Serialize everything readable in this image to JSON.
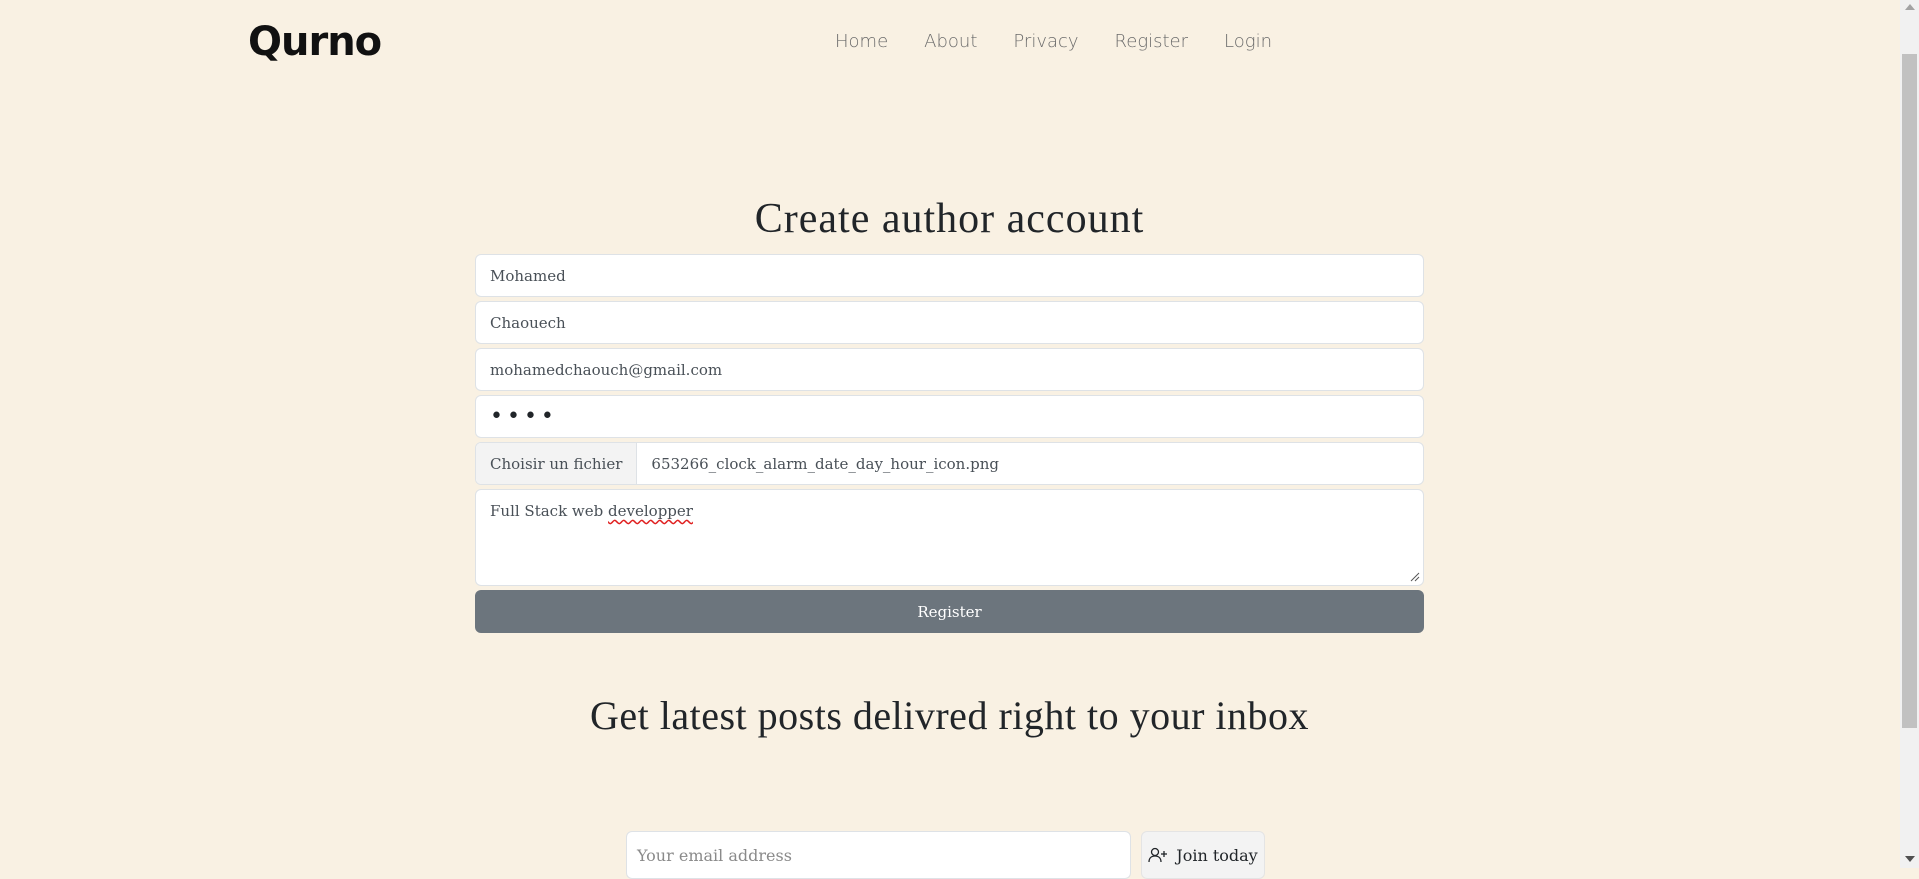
{
  "header": {
    "logo": "Qurno",
    "nav": [
      "Home",
      "About",
      "Privacy",
      "Register",
      "Login"
    ]
  },
  "register_form": {
    "title": "Create author account",
    "first_name": "Mohamed",
    "last_name": "Chaouech",
    "email": "mohamedchaouch@gmail.com",
    "password_mask": "••••",
    "file_button": "Choisir un fichier",
    "file_name": "653266_clock_alarm_date_day_hour_icon.png",
    "bio_start": "Full Stack web ",
    "bio_misspelled": "developper",
    "submit": "Register"
  },
  "newsletter": {
    "title": "Get latest posts delivred right to your inbox",
    "email_placeholder": "Your email address",
    "join_label": "Join today"
  },
  "colors": {
    "background": "#f9f1e3",
    "button": "#6c757d"
  }
}
